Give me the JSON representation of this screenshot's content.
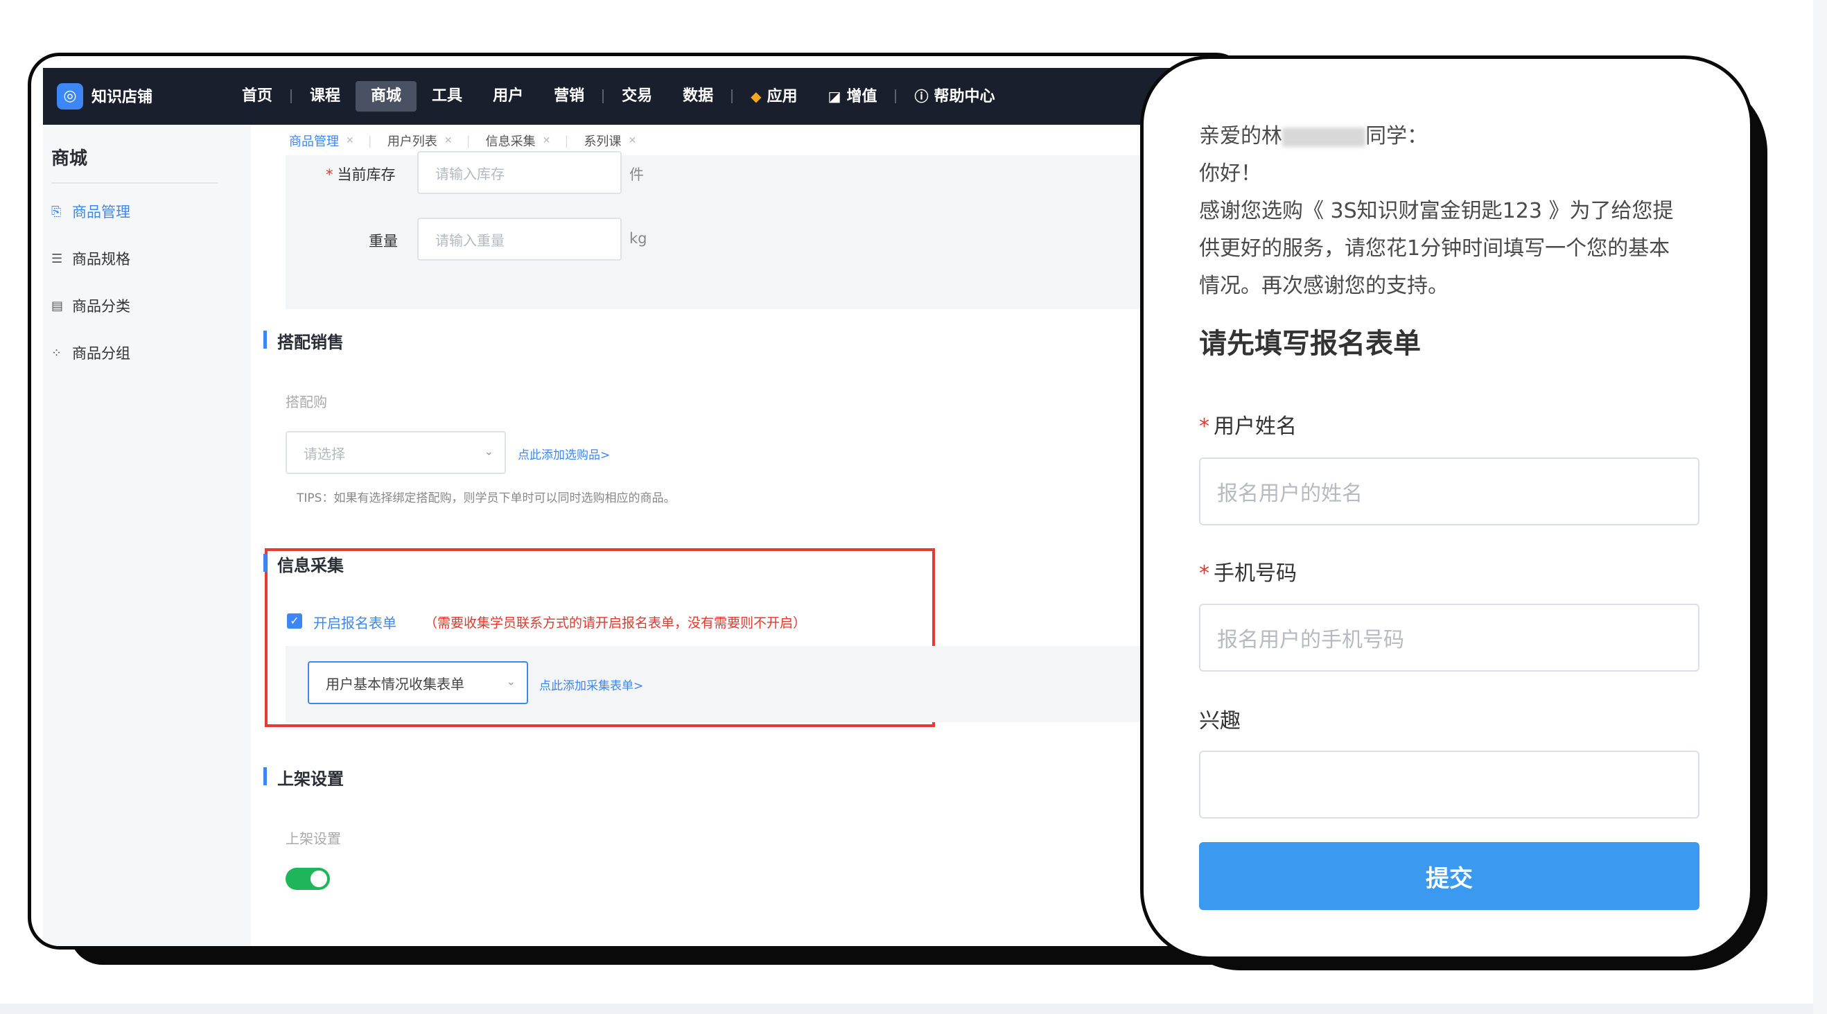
{
  "admin": {
    "brand": "知识店铺",
    "nav": [
      {
        "label": "首页",
        "active": false
      },
      {
        "label": "课程",
        "active": false
      },
      {
        "label": "商城",
        "active": true
      },
      {
        "label": "工具",
        "active": false
      },
      {
        "label": "用户",
        "active": false
      },
      {
        "label": "营销",
        "active": false
      },
      {
        "label": "交易",
        "active": false
      },
      {
        "label": "数据",
        "active": false
      },
      {
        "label": "应用",
        "icon": "cube-icon"
      },
      {
        "label": "增值",
        "icon": "chart-icon"
      },
      {
        "label": "帮助中心",
        "icon": "help-icon"
      }
    ],
    "sidebar": {
      "title": "商城",
      "items": [
        {
          "label": "商品管理",
          "icon": "goods-icon",
          "active": true
        },
        {
          "label": "商品规格",
          "icon": "list-icon"
        },
        {
          "label": "商品分类",
          "icon": "category-icon"
        },
        {
          "label": "商品分组",
          "icon": "group-icon"
        }
      ]
    },
    "tabs": [
      "商品管理",
      "用户列表",
      "信息采集",
      "系列课"
    ],
    "stock": {
      "label": "当前库存",
      "placeholder": "请输入库存",
      "unit": "件"
    },
    "weight": {
      "label": "重量",
      "placeholder": "请输入重量",
      "unit": "kg"
    },
    "bundle": {
      "title": "搭配销售",
      "label": "搭配购",
      "select_placeholder": "请选择",
      "add_link": "点此添加选购品>",
      "tips": "TIPS：如果有选择绑定搭配购，则学员下单时可以同时选购相应的商品。"
    },
    "info": {
      "title": "信息采集",
      "checkbox_label": "开启报名表单",
      "note": "（需要收集学员联系方式的请开启报名表单，没有需要则不开启）",
      "select_value": "用户基本情况收集表单",
      "add_link": "点此添加采集表单>"
    },
    "shelf": {
      "title": "上架设置",
      "label": "上架设置",
      "toggle_on": true
    }
  },
  "phone": {
    "greeting_prefix": "亲爱的林",
    "greeting_suffix": "同学：",
    "hello": "你好！",
    "line1": "感谢您选购《 3S知识财富金钥匙123 》为了给您提",
    "line2": "供更好的服务，请您花1分钟时间填写一个您的基本",
    "line3": "情况。再次感谢您的支持。",
    "form_title": "请先填写报名表单",
    "name_label": "用户姓名",
    "name_placeholder": "报名用户的姓名",
    "phone_label": "手机号码",
    "phone_placeholder": "报名用户的手机号码",
    "interest_label": "兴趣",
    "submit": "提交"
  },
  "colors": {
    "accent": "#3c87f5",
    "topbar": "#1a1f2d",
    "highlight": "#e63a35",
    "toggle": "#1fb65b",
    "submit": "#3b99f0"
  }
}
